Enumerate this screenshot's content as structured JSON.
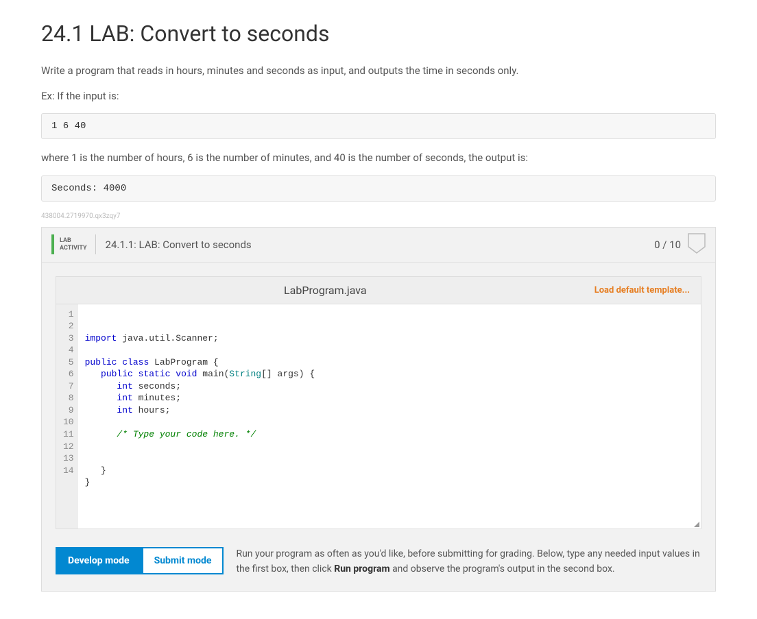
{
  "title": "24.1 LAB: Convert to seconds",
  "intro": {
    "p1": "Write a program that reads in hours, minutes and seconds as input, and outputs the time in seconds only.",
    "p2": "Ex: If the input is:",
    "example_in": "1 6 40",
    "p3": "where 1 is the number of hours, 6 is the number of minutes, and 40 is the number of seconds, the output is:",
    "example_out": "Seconds: 4000"
  },
  "tiny_id": "438004.2719970.qx3zqy7",
  "lab": {
    "badge_line1": "LAB",
    "badge_line2": "ACTIVITY",
    "title": "24.1.1: LAB: Convert to seconds",
    "score": "0 / 10",
    "filename": "LabProgram.java",
    "load_template_label": "Load default template...",
    "code_lines": [
      {
        "n": 1,
        "tokens": [
          {
            "t": "import",
            "c": "kw"
          },
          {
            "t": " java.util.Scanner;",
            "c": ""
          }
        ]
      },
      {
        "n": 2,
        "tokens": []
      },
      {
        "n": 3,
        "tokens": [
          {
            "t": "public",
            "c": "kw"
          },
          {
            "t": " ",
            "c": ""
          },
          {
            "t": "class",
            "c": "kw"
          },
          {
            "t": " LabProgram {",
            "c": ""
          }
        ]
      },
      {
        "n": 4,
        "tokens": [
          {
            "t": "   ",
            "c": ""
          },
          {
            "t": "public",
            "c": "kw"
          },
          {
            "t": " ",
            "c": ""
          },
          {
            "t": "static",
            "c": "kw"
          },
          {
            "t": " ",
            "c": ""
          },
          {
            "t": "void",
            "c": "kw"
          },
          {
            "t": " main(",
            "c": ""
          },
          {
            "t": "String",
            "c": "type"
          },
          {
            "t": "[] args) {",
            "c": ""
          }
        ]
      },
      {
        "n": 5,
        "tokens": [
          {
            "t": "      ",
            "c": ""
          },
          {
            "t": "int",
            "c": "kw"
          },
          {
            "t": " seconds;",
            "c": ""
          }
        ]
      },
      {
        "n": 6,
        "tokens": [
          {
            "t": "      ",
            "c": ""
          },
          {
            "t": "int",
            "c": "kw"
          },
          {
            "t": " minutes;",
            "c": ""
          }
        ]
      },
      {
        "n": 7,
        "tokens": [
          {
            "t": "      ",
            "c": ""
          },
          {
            "t": "int",
            "c": "kw"
          },
          {
            "t": " hours;",
            "c": ""
          }
        ]
      },
      {
        "n": 8,
        "tokens": []
      },
      {
        "n": 9,
        "tokens": [
          {
            "t": "      ",
            "c": ""
          },
          {
            "t": "/* Type your code here. */",
            "c": "comment"
          }
        ]
      },
      {
        "n": 10,
        "tokens": []
      },
      {
        "n": 11,
        "tokens": []
      },
      {
        "n": 12,
        "tokens": [
          {
            "t": "   }",
            "c": ""
          }
        ]
      },
      {
        "n": 13,
        "tokens": [
          {
            "t": "}",
            "c": ""
          }
        ]
      },
      {
        "n": 14,
        "tokens": []
      }
    ]
  },
  "modes": {
    "develop_label": "Develop mode",
    "submit_label": "Submit mode",
    "desc_pre": "Run your program as often as you'd like, before submitting for grading. Below, type any needed input values in the first box, then click ",
    "desc_bold": "Run program",
    "desc_post": " and observe the program's output in the second box."
  }
}
